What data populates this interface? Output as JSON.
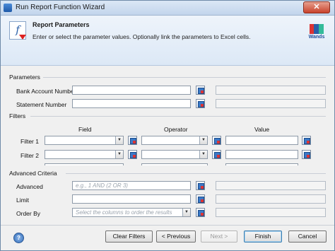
{
  "window": {
    "title": "Run Report Function Wizard",
    "close_glyph": "✕"
  },
  "header": {
    "title": "Report Parameters",
    "description": "Enter or select the parameter values. Optionally link the parameters to Excel cells.",
    "logo_text": "Wands",
    "icon_glyph": "f"
  },
  "parameters": {
    "section_label": "Parameters",
    "bank_account_label": "Bank Account Number",
    "statement_number_label": "Statement Number"
  },
  "filters": {
    "section_label": "Filters",
    "columns": {
      "field": "Field",
      "operator": "Operator",
      "value": "Value"
    },
    "rows": [
      {
        "label": "Filter 1"
      },
      {
        "label": "Filter 2"
      }
    ],
    "dropdown_glyph": "▼"
  },
  "advanced": {
    "section_label": "Advanced Criteria",
    "advanced_label": "Advanced",
    "advanced_placeholder": "e.g., 1 AND (2 OR 3)",
    "limit_label": "Limit",
    "order_by_label": "Order By",
    "order_by_placeholder": "Select the columns to order the results"
  },
  "footer": {
    "help_glyph": "?",
    "clear_filters": "Clear Filters",
    "previous": "< Previous",
    "next": "Next >",
    "finish": "Finish",
    "cancel": "Cancel"
  }
}
